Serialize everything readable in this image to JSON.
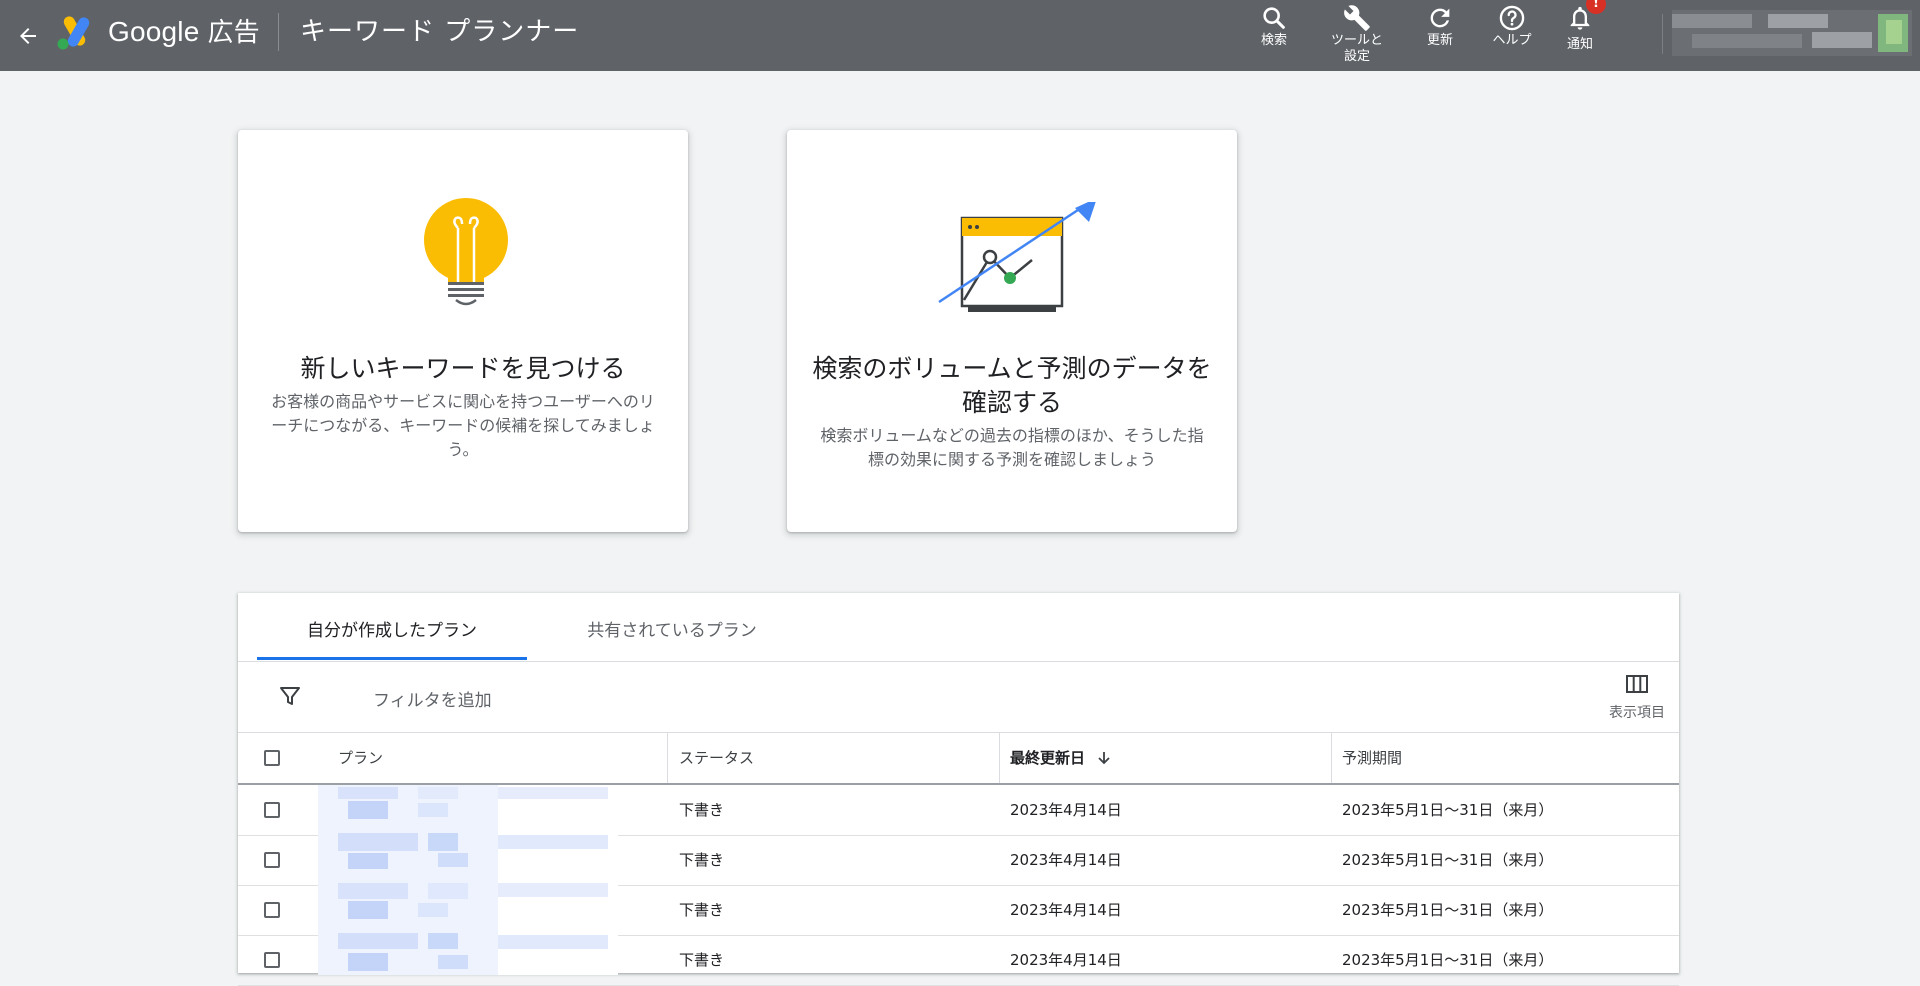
{
  "topbar": {
    "brand": "Google",
    "brand_suffix": "広告",
    "page_title": "キーワード プランナー",
    "tools": [
      {
        "icon": "search-icon",
        "label": "検索"
      },
      {
        "icon": "wrench-icon",
        "label": "ツールと\n設定"
      },
      {
        "icon": "refresh-icon",
        "label": "更新"
      },
      {
        "icon": "help-icon",
        "label": "ヘルプ"
      },
      {
        "icon": "bell-icon",
        "label": "通知"
      }
    ],
    "notification_badge": "!"
  },
  "cards": [
    {
      "icon": "lightbulb-icon",
      "title": "新しいキーワードを見つける",
      "description": "お客様の商品やサービスに関心を持つユーザーへのリーチにつながる、キーワードの候補を探してみましょう。"
    },
    {
      "icon": "chart-trend-icon",
      "title": "検索のボリュームと予測のデータを確認する",
      "description": "検索ボリュームなどの過去の指標のほか、そうした指標の効果に関する予測を確認しましょう"
    }
  ],
  "tabs": [
    {
      "label": "自分が作成したプラン",
      "active": true
    },
    {
      "label": "共有されているプラン",
      "active": false
    }
  ],
  "filter": {
    "placeholder": "フィルタを追加"
  },
  "columns_button": "表示項目",
  "table": {
    "headers": [
      "プラン",
      "ステータス",
      "最終更新日",
      "予測期間"
    ],
    "sorted_column": "最終更新日",
    "sort_direction": "descending",
    "rows": [
      {
        "status": "下書き",
        "updated": "2023年4月14日",
        "period": "2023年5月1日〜31日（来月）"
      },
      {
        "status": "下書き",
        "updated": "2023年4月14日",
        "period": "2023年5月1日〜31日（来月）"
      },
      {
        "status": "下書き",
        "updated": "2023年4月14日",
        "period": "2023年5月1日〜31日（来月）"
      },
      {
        "status": "下書き",
        "updated": "2023年4月14日",
        "period": "2023年5月1日〜31日（来月）"
      }
    ]
  },
  "colors": {
    "topbar": "#5f6368",
    "background": "#f1f3f4",
    "accent_blue": "#1a73e8",
    "bulb_yellow": "#fbbc04",
    "badge_red": "#d93025"
  }
}
